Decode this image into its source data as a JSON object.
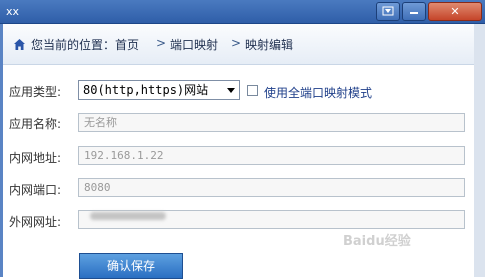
{
  "window": {
    "title": "xx"
  },
  "breadcrumb": {
    "current_location": "您当前的位置：首页",
    "separator": ">",
    "items": [
      "端口映射",
      "映射编辑"
    ]
  },
  "form": {
    "type": {
      "label": "应用类型:",
      "selected": "80(http,https)网站"
    },
    "port_mode_checkbox": {
      "label": "使用全端口映射模式",
      "checked": false
    },
    "app_name": {
      "label": "应用名称:",
      "value": "无名称"
    },
    "lan_address": {
      "label": "内网地址:",
      "value": "192.168.1.22"
    },
    "lan_port": {
      "label": "内网端口:",
      "value": "8080"
    },
    "wan_address": {
      "label": "外网网址:",
      "value": ""
    }
  },
  "save_button": {
    "label": "确认保存"
  },
  "colors": {
    "title_bar": "#2f5ea8",
    "accent_link": "#1f3f8a",
    "save_button": "#2a6fc2"
  },
  "watermark": {
    "text": "Baidu经验"
  }
}
